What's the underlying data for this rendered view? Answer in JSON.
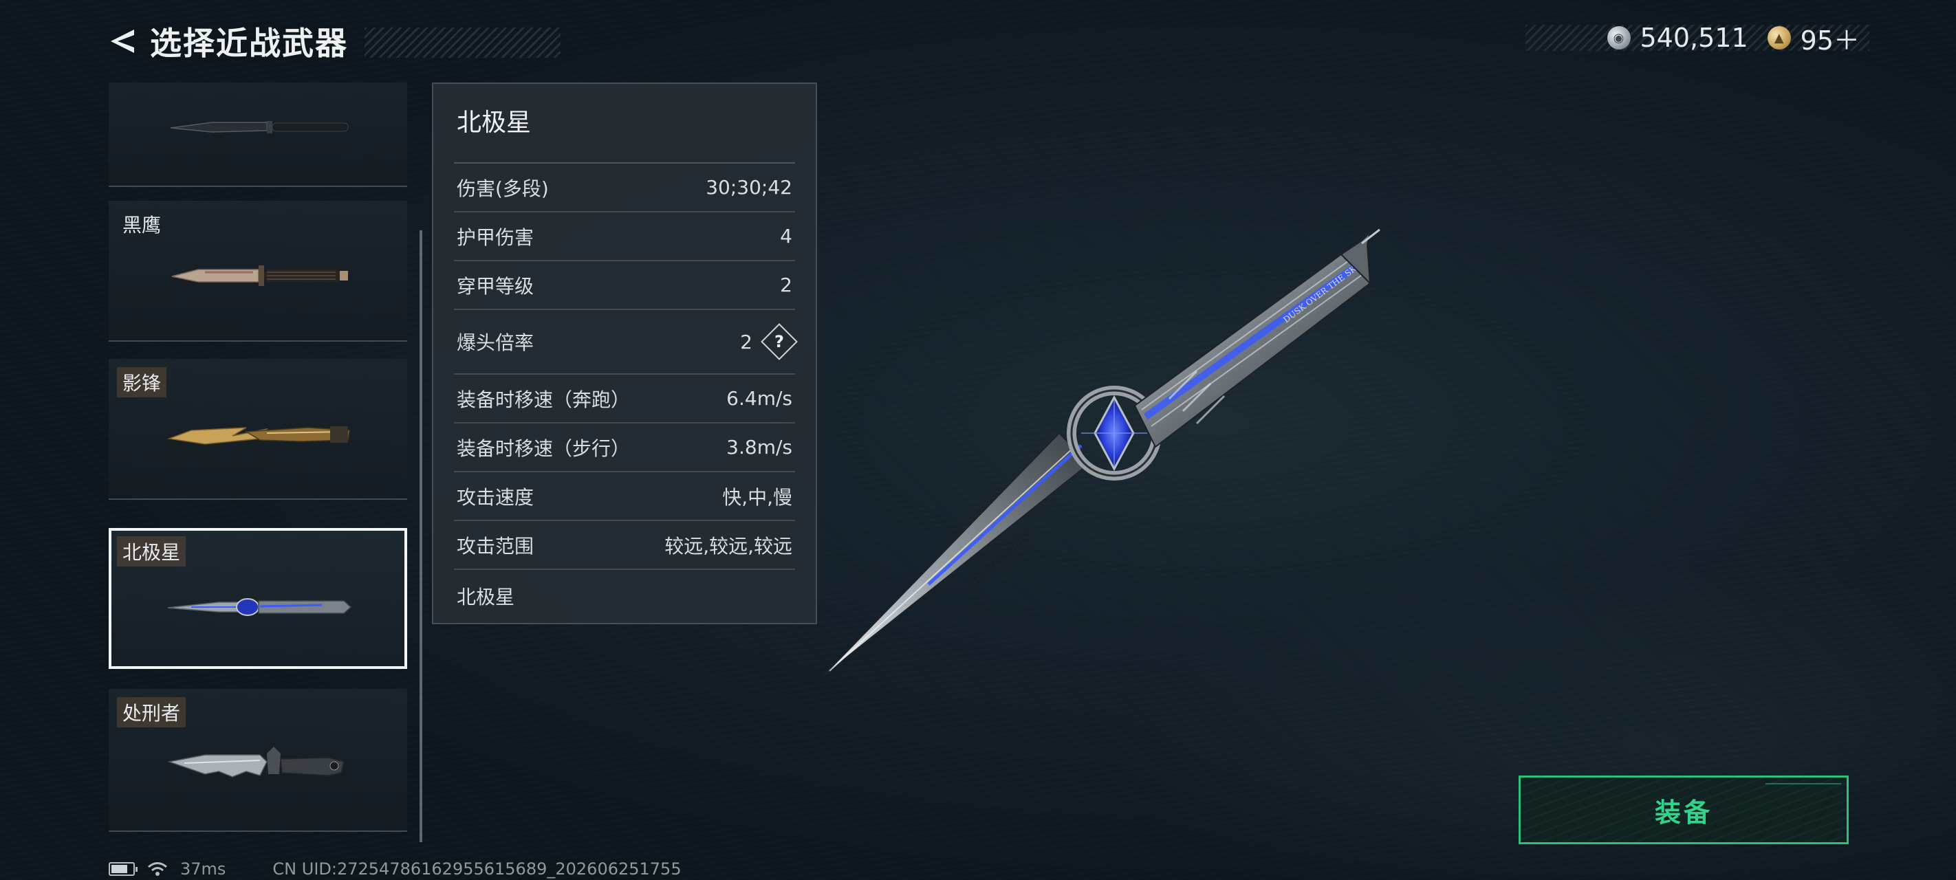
{
  "header": {
    "title": "选择近战武器",
    "back_icon": "back-chevron-icon"
  },
  "currency": {
    "silver_amount": "540,511",
    "gold_amount": "95＋"
  },
  "weapon_list": [
    {
      "name": "",
      "image": "combat-knife",
      "selected": false
    },
    {
      "name": "黑鹰",
      "image": "black-eagle-knife",
      "selected": false
    },
    {
      "name": "影锋",
      "image": "shadow-blade",
      "selected": false
    },
    {
      "name": "北极星",
      "image": "polaris-blade",
      "selected": true
    },
    {
      "name": "处刑者",
      "image": "executioner-knife",
      "selected": false
    }
  ],
  "stats": {
    "title": "北极星",
    "rows": [
      {
        "label": "伤害(多段)",
        "value": "30;30;42"
      },
      {
        "label": "护甲伤害",
        "value": "4"
      },
      {
        "label": "穿甲等级",
        "value": "2"
      },
      {
        "label": "爆头倍率",
        "value": "2",
        "help": "?"
      },
      {
        "label": "装备时移速（奔跑）",
        "value": "6.4m/s"
      },
      {
        "label": "装备时移速（步行）",
        "value": "3.8m/s"
      },
      {
        "label": "攻击速度",
        "value": "快,中,慢"
      },
      {
        "label": "攻击范围",
        "value": "较远,较远,较远"
      }
    ],
    "footer": "北极星"
  },
  "equip_button": {
    "label": "装备"
  },
  "status": {
    "ping": "37ms",
    "uid": "CN UID:2725478616295561568​9_202606251755",
    "battery_level": 0.75
  },
  "colors": {
    "accent_green": "#34d38a",
    "blade_blue": "#3a5bff"
  }
}
